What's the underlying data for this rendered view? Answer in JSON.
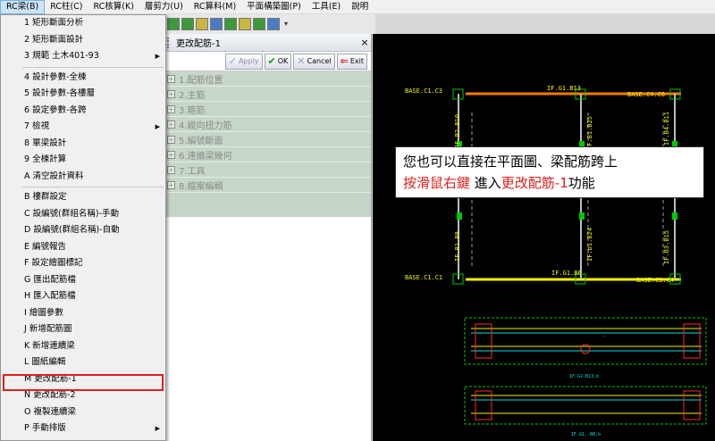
{
  "menubar": [
    {
      "label": "RC梁(B)",
      "active": true
    },
    {
      "label": "RC柱(C)"
    },
    {
      "label": "RC核算(K)"
    },
    {
      "label": "層剪力(U)"
    },
    {
      "label": "RC算料(M)"
    },
    {
      "label": "平面構築圖(P)"
    },
    {
      "label": "工具(E)"
    },
    {
      "label": "說明"
    }
  ],
  "dropdown": {
    "group1": [
      {
        "label": "1 矩形斷面分析"
      },
      {
        "label": "2 矩形斷面設計"
      },
      {
        "label": "3 規範 土木401-93",
        "submenu": true
      }
    ],
    "group2": [
      {
        "label": "4 設計參數-全棟"
      },
      {
        "label": "5 設計參數-各樓層"
      },
      {
        "label": "6 設定參數-各跨"
      },
      {
        "label": "7 檢視",
        "submenu": true
      },
      {
        "label": "8 單梁設計"
      },
      {
        "label": "9 全棟計算"
      },
      {
        "label": "A 清空設計資料"
      }
    ],
    "group3": [
      {
        "label": "B 樓群設定"
      },
      {
        "label": "C 設編號(群組名稱)-手動"
      },
      {
        "label": "D 設編號(群組名稱)-自動"
      },
      {
        "label": "E 編號報告"
      },
      {
        "label": "F 設定繪圖標記"
      },
      {
        "label": "G 匯出配筋檔"
      },
      {
        "label": "H 匯入配筋檔"
      },
      {
        "label": "I 繪圖參數"
      },
      {
        "label": "J 新增配筋圖"
      },
      {
        "label": "K 新增連續梁"
      },
      {
        "label": "L 圖紙編輯"
      },
      {
        "label": "M 更改配筋-1",
        "highlighted": true
      },
      {
        "label": "N 更改配筋-2"
      },
      {
        "label": "O 複製連續梁"
      },
      {
        "label": "P 手動排版",
        "submenu": true
      }
    ]
  },
  "panel": {
    "title": "更改配筋-1",
    "close": "×",
    "buttons": {
      "apply": "Apply",
      "ok": "OK",
      "cancel": "Cancel",
      "exit": "Exit"
    },
    "tree": [
      "1.配筋位置",
      "2.主筋",
      "3.箍筋",
      "4.縱向扭力筋",
      "5.編號斷面",
      "6.連續梁幾何",
      "7.工具",
      "8.檔案編輯"
    ]
  },
  "callout": {
    "line1": "您也可以直接在平面圖、梁配筋跨上",
    "line2_red": "按滑鼠右鍵",
    "line2_mid": " 進入",
    "line2_red2": "更改配筋-1",
    "line2_end": "功能"
  },
  "cad": {
    "labels": {
      "base_c1_c3": "BASE.C1.C3",
      "g1_b13": "IF.G1.B13",
      "base_c4_c6": "BASE.C4.C6",
      "b2_b10": "IF.B2.B10",
      "b1_b25": "IF.B1.B25",
      "b4_b11": "IF.B4.B11",
      "b1_b9": "IF.B1.B9",
      "b1_b24": "IF.b1.B24",
      "b3_b15": "IF.B3.B15",
      "base_c1_c1": "BASE.C1.C1",
      "g1_b6": "IF.G1.B6",
      "base_c3_c4": "BASE.C3.C4",
      "detail1": "IF.G1-B13.b",
      "detail2": "IF.G1.-B6.b"
    },
    "colors": {
      "yellow": "#f5f500",
      "orange": "#ff7a00",
      "green": "#00c800",
      "cyan": "#00e0e0",
      "red": "#ff2a2a"
    }
  }
}
